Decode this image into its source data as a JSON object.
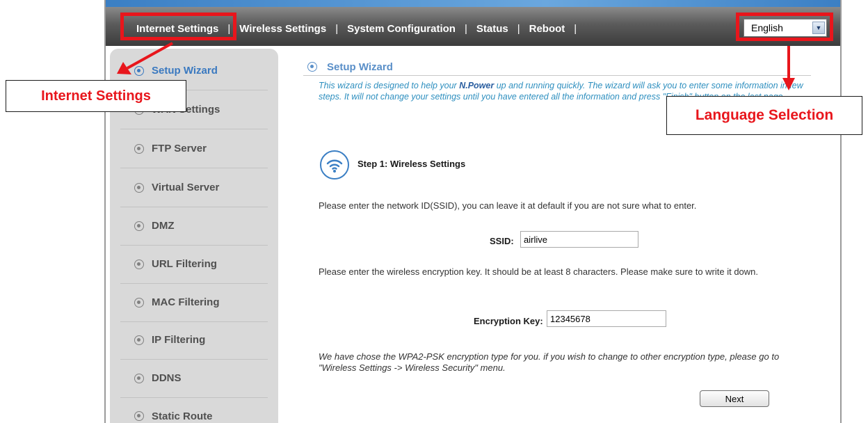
{
  "navbar": {
    "items": [
      {
        "label": "Internet Settings"
      },
      {
        "label": "Wireless Settings"
      },
      {
        "label": "System Configuration"
      },
      {
        "label": "Status"
      },
      {
        "label": "Reboot"
      }
    ],
    "separator": "|",
    "language": {
      "selected": "English"
    }
  },
  "sidebar": {
    "items": [
      {
        "label": "Setup Wizard",
        "active": true
      },
      {
        "label": "WAN Settings"
      },
      {
        "label": "FTP Server"
      },
      {
        "label": "Virtual Server"
      },
      {
        "label": "DMZ"
      },
      {
        "label": "URL Filtering"
      },
      {
        "label": "MAC Filtering"
      },
      {
        "label": "IP Filtering"
      },
      {
        "label": "DDNS"
      },
      {
        "label": "Static Route"
      }
    ]
  },
  "main": {
    "title": "Setup Wizard",
    "intro_part1": "This wizard is designed to help your",
    "brand": "N.Power",
    "intro_part2": "up and running quickly. The wizard will ask you to enter some information in few steps. It will not change your settings until you have entered all the information and press \"Finish\" button on the last page.",
    "step_prefix": "Step 1:",
    "step_name": "Wireless Settings",
    "ssid_prompt": "Please enter the network ID(SSID), you can leave it at default if you are not sure what to enter.",
    "ssid_label": "SSID:",
    "ssid_value": "airlive",
    "key_prompt": "Please enter the wireless encryption key. It should be at least 8 characters. Please make sure to write it down.",
    "key_label": "Encryption Key:",
    "key_value": "12345678",
    "note": "We have chose the WPA2-PSK encryption type for you.  if you wish to change to other encryption type, please go to \"Wireless Settings -> Wireless Security\" menu.",
    "next_label": "Next"
  },
  "annotations": {
    "internet_settings": "Internet Settings",
    "language_selection": "Language Selection",
    "color": "#e8161c"
  },
  "colors": {
    "accent": "#3a79c0",
    "intro_text": "#2e8fbf",
    "navbar_dark": "#3c3c3c",
    "sidebar_bg": "#d9d9d9"
  },
  "icons": {
    "sidebar_bullet": "radio-bullet-icon",
    "step": "wifi-icon",
    "dropdown": "chevron-down-icon"
  }
}
